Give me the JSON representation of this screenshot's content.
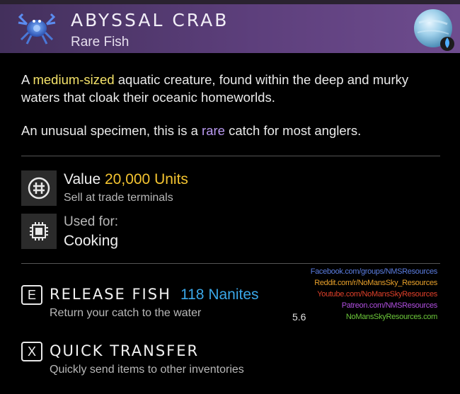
{
  "header": {
    "title": "ABYSSAL CRAB",
    "subtitle": "Rare Fish",
    "accent_color": "#5d3f7c"
  },
  "description": {
    "p1_before": "A ",
    "p1_highlight": "medium-sized",
    "p1_after": " aquatic creature, found within the deep and murky waters that cloak their oceanic homeworlds.",
    "p2_before": "An unusual specimen, this is a ",
    "p2_highlight": "rare",
    "p2_after": " catch for most anglers."
  },
  "value": {
    "label": "Value",
    "amount": "20,000 Units",
    "sub": "Sell at trade terminals",
    "icon": "units-icon"
  },
  "used_for": {
    "label": "Used for:",
    "value": "Cooking",
    "icon": "cooking-chip-icon"
  },
  "actions": [
    {
      "key": "E",
      "label": "RELEASE FISH",
      "reward": "118 Nanites",
      "sub": "Return your catch to the water"
    },
    {
      "key": "X",
      "label": "QUICK TRANSFER",
      "sub": "Quickly send items to other inventories"
    }
  ],
  "credits": [
    {
      "text": "Facebook.com/groups/NMSResources",
      "color": "#5b7de0"
    },
    {
      "text": "Reddit.com/r/NoMansSky_Resources",
      "color": "#e8a02a"
    },
    {
      "text": "Youtube.com/NoMansSkyResources",
      "color": "#e0402a"
    },
    {
      "text": "Patreon.com/NMSResources",
      "color": "#b04fe0"
    },
    {
      "text": "NoMansSkyResources.com",
      "color": "#6cc83a"
    }
  ],
  "version": "5.6"
}
